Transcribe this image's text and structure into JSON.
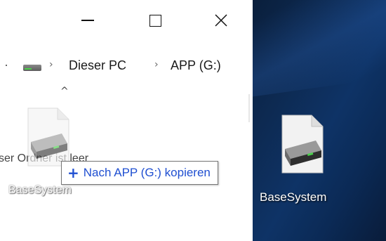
{
  "window": {
    "controls": {
      "minimize_icon": "minimize-icon",
      "maximize_icon": "maximize-icon",
      "close_icon": "close-icon"
    }
  },
  "address_bar": {
    "drive_icon": "drive-icon",
    "separator": "›",
    "crumbs": [
      "Dieser PC",
      "APP (G:)"
    ]
  },
  "content": {
    "empty_message": "ser Ordner ist leer",
    "drag_ghost_label": "BaseSystem"
  },
  "drag_tooltip": {
    "icon": "plus-icon",
    "text": "Nach APP (G:) kopieren",
    "color": "#1f4fd1"
  },
  "desktop": {
    "icon_label": "BaseSystem"
  },
  "colors": {
    "desktop_bg": "#0e3366",
    "accent": "#1f4fd1"
  }
}
